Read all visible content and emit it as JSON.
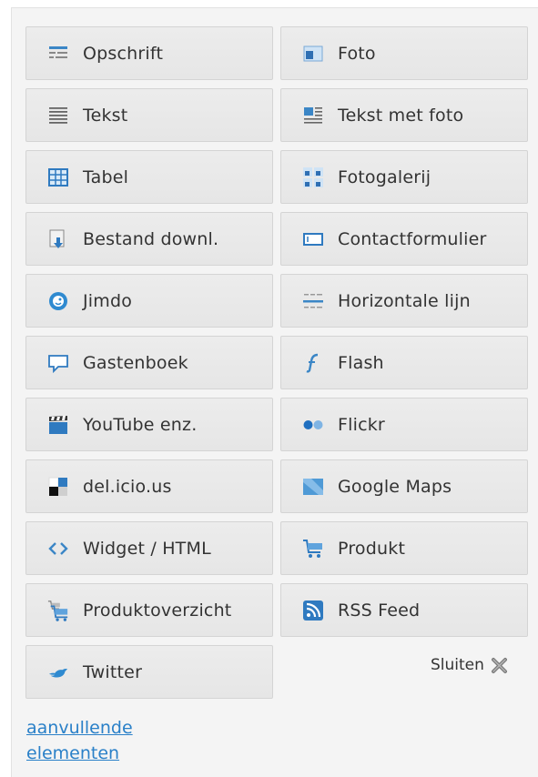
{
  "elements": [
    {
      "label": "Opschrift",
      "icon": "heading-icon"
    },
    {
      "label": "Foto",
      "icon": "photo-icon"
    },
    {
      "label": "Tekst",
      "icon": "text-icon"
    },
    {
      "label": "Tekst met foto",
      "icon": "text-with-photo-icon"
    },
    {
      "label": "Tabel",
      "icon": "table-icon"
    },
    {
      "label": "Fotogalerij",
      "icon": "photo-gallery-icon"
    },
    {
      "label": "Bestand downl.",
      "icon": "file-download-icon"
    },
    {
      "label": "Contactformulier",
      "icon": "contact-form-icon"
    },
    {
      "label": "Jimdo",
      "icon": "jimdo-icon"
    },
    {
      "label": "Horizontale lijn",
      "icon": "horizontal-line-icon"
    },
    {
      "label": "Gastenboek",
      "icon": "guestbook-icon"
    },
    {
      "label": "Flash",
      "icon": "flash-icon"
    },
    {
      "label": "YouTube enz.",
      "icon": "video-icon"
    },
    {
      "label": "Flickr",
      "icon": "flickr-icon"
    },
    {
      "label": "del.icio.us",
      "icon": "delicious-icon"
    },
    {
      "label": "Google Maps",
      "icon": "map-icon"
    },
    {
      "label": "Widget / HTML",
      "icon": "code-icon"
    },
    {
      "label": "Produkt",
      "icon": "cart-icon"
    },
    {
      "label": "Produktoverzicht",
      "icon": "cart-overview-icon"
    },
    {
      "label": "RSS Feed",
      "icon": "rss-icon"
    },
    {
      "label": "Twitter",
      "icon": "twitter-bird-icon"
    }
  ],
  "close": {
    "label": "Sluiten",
    "icon": "close-x-icon"
  },
  "more_link": {
    "line1": "aanvullende",
    "line2": "elementen"
  },
  "colors": {
    "accent": "#2a80c8",
    "button_bg": "#e8e8e8",
    "panel_bg": "#f4f4f4"
  }
}
